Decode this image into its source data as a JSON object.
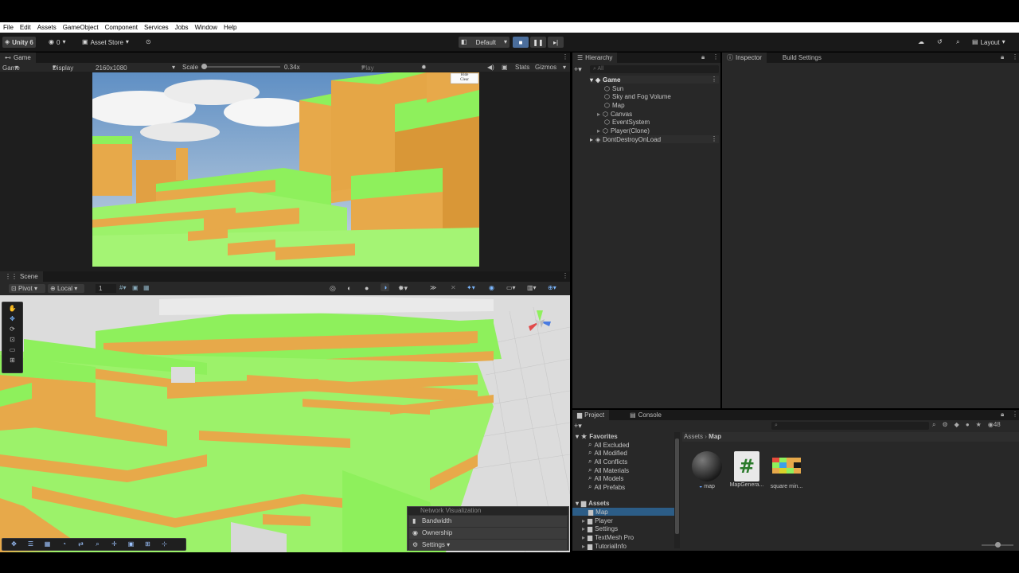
{
  "menu": [
    "File",
    "Edit",
    "Assets",
    "GameObject",
    "Component",
    "Services",
    "Jobs",
    "Window",
    "Help"
  ],
  "toolbar": {
    "unity_label": "Unity 6",
    "account_count": "0",
    "asset_store": "Asset Store",
    "build_profile": "Default",
    "layout": "Layout"
  },
  "game": {
    "tab": "Game",
    "mode": "Game",
    "display": "Display 1",
    "resolution": "2160x1080",
    "scale_label": "Scale",
    "scale_value": "0.34x",
    "focus": "Play Focused",
    "stats": "Stats",
    "gizmos": "Gizmos",
    "overlay_lines": [
      "Hide",
      "Clear"
    ]
  },
  "scene": {
    "tab": "Scene",
    "pivot": "Pivot",
    "local": "Local",
    "grid_value": "1",
    "netvis": {
      "title": "Network Visualization",
      "items": [
        "Bandwidth",
        "Ownership",
        "Settings ▾"
      ]
    }
  },
  "hierarchy": {
    "tab": "Hierarchy",
    "search_placeholder": "All",
    "scene_name": "Game",
    "items": [
      "Sun",
      "Sky and Fog Volume",
      "Map",
      "Canvas",
      "EventSystem",
      "Player(Clone)"
    ],
    "ddol": "DontDestroyOnLoad"
  },
  "inspector": {
    "tab": "Inspector",
    "build_settings": "Build Settings"
  },
  "project": {
    "tab": "Project",
    "console_tab": "Console",
    "favorites_label": "Favorites",
    "favorites": [
      "All Excluded",
      "All Modified",
      "All Conflicts",
      "All Materials",
      "All Models",
      "All Prefabs"
    ],
    "assets_label": "Assets",
    "folders": [
      "Map",
      "Player",
      "Settings",
      "TextMesh Pro",
      "TutorialInfo"
    ],
    "breadcrumb": [
      "Assets",
      "Map"
    ],
    "asset_files": [
      "map",
      "MapGenera...",
      "square min..."
    ],
    "hidden_count": "48"
  },
  "colors": {
    "grass": "#8ef05c",
    "dirt": "#e7a94a",
    "panel_bg": "#282828",
    "tab_bg": "#191919",
    "accent": "#4b6e9c",
    "selection": "#2c5d87"
  }
}
